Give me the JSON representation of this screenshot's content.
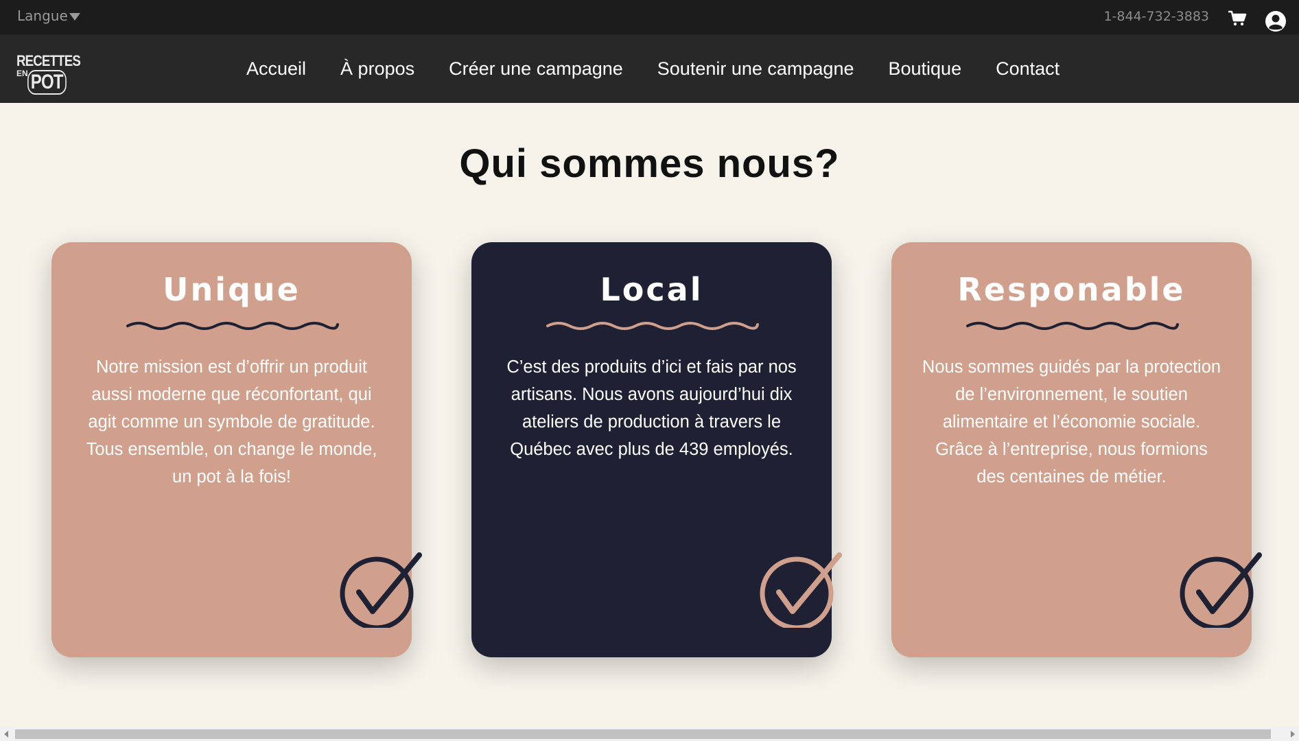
{
  "topbar": {
    "language_label": "Langue",
    "phone": "1-844-732-3883",
    "cart_icon": "cart-icon",
    "user_icon": "user-account-icon"
  },
  "logo": {
    "line1": "RECETTES",
    "line2": "EN",
    "line3": "POT"
  },
  "nav": {
    "items": [
      "Accueil",
      "À propos",
      "Créer une campagne",
      "Soutenir une campagne",
      "Boutique",
      "Contact"
    ]
  },
  "section": {
    "title": "Qui sommes nous?"
  },
  "cards": [
    {
      "title": "Unique",
      "text": "Notre mission est d’offrir un produit aussi moderne que réconfortant, qui agit comme un symbole de gratitude. Tous ensemble, on change le monde, un pot à la fois!",
      "background": "#d0a08d",
      "accent": "#1e2133",
      "icon": "checkmark-circle-icon"
    },
    {
      "title": "Local",
      "text": "C’est des produits d’ici et fais par nos artisans. Nous avons aujourd’hui dix ateliers de production à travers le Québec avec plus de 439 employés.",
      "background": "#1e2133",
      "accent": "#d0a08d",
      "icon": "checkmark-circle-icon"
    },
    {
      "title": "Responable",
      "text": "Nous sommes guidés par la protection de l’environnement, le soutien alimentaire et l’économie sociale. Grâce à l’entreprise, nous formions des centaines de métier.",
      "background": "#d0a08d",
      "accent": "#1e2133",
      "icon": "checkmark-circle-icon"
    }
  ],
  "colors": {
    "page_background": "#f5f3ea",
    "topbar": "#1c1c1c",
    "navbar": "#282828",
    "pink": "#d0a08d",
    "navy": "#1e2133"
  }
}
